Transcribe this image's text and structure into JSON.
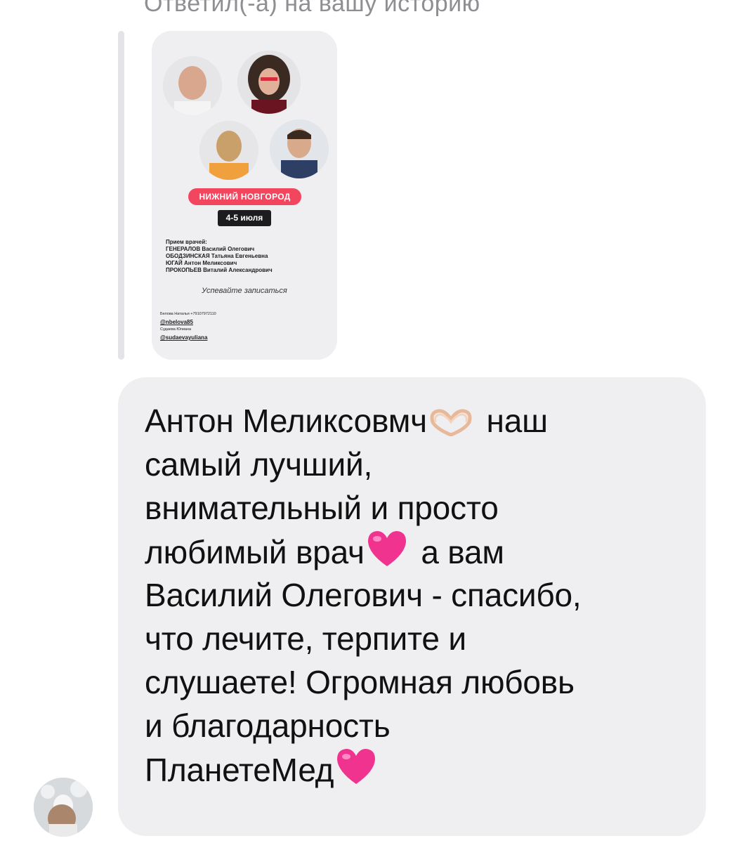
{
  "reply_header": "Ответил(-а) на вашу историю",
  "story": {
    "city": "НИЖНИЙ НОВГОРОД",
    "dates": "4-5 июля",
    "list_title": "Прием врачей:",
    "doctors": [
      "ГЕНЕРАЛОВ Василий Олегович",
      "ОБОДЗИНСКАЯ Татьяна Евгеньевна",
      "ЮГАЙ Антон Меликсович",
      "ПРОКОПЬЕВ Виталий Александрович"
    ],
    "cta": "Успевайте записаться",
    "contact1_name": "Белова Наталья +79107972110",
    "contact1_handle": "@nbelova85",
    "contact2_name": "Судаева Юлиана",
    "contact2_handle": "@sudaevayuliana"
  },
  "message": {
    "lines": [
      "Антон Меликсовмч",
      "наш",
      "самый лучший,",
      "внимательный и просто",
      "любимый врач",
      "а вам",
      "Василий Олегович - спасибо,",
      "что лечите, терпите и",
      "слушаете! Огромная любовь",
      "и благодарность",
      "ПланетеМед"
    ],
    "emojis": [
      "heart-hands",
      "pink-heart",
      "pink-heart"
    ]
  },
  "colors": {
    "bubble": "#efeff1",
    "city_pill": "#f2465f",
    "heart": "#f0338f"
  }
}
